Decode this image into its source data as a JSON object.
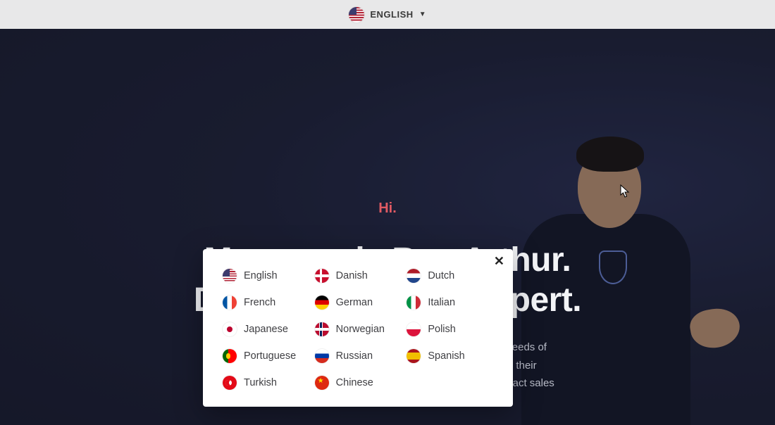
{
  "topbar": {
    "current_language_label": "ENGLISH",
    "current_language_flag": "us"
  },
  "hero": {
    "greeting": "Hi.",
    "headline_line1": "My name is Ben Arthur.",
    "headline_line2": "Digital Marketing Expert.",
    "sub_line1": "Beautiful websites and application often fail to address real needs of",
    "sub_line2": "your visitors. This results in visitors not finding a solution to their",
    "sub_line3": "problems, and then of course, website and apps that fail to attract sales"
  },
  "popup": {
    "close_glyph": "✕",
    "languages": [
      {
        "flag": "us",
        "label": "English"
      },
      {
        "flag": "dk",
        "label": "Danish"
      },
      {
        "flag": "nl",
        "label": "Dutch"
      },
      {
        "flag": "fr",
        "label": "French"
      },
      {
        "flag": "de",
        "label": "German"
      },
      {
        "flag": "it",
        "label": "Italian"
      },
      {
        "flag": "jp",
        "label": "Japanese"
      },
      {
        "flag": "no",
        "label": "Norwegian"
      },
      {
        "flag": "pl",
        "label": "Polish"
      },
      {
        "flag": "pt",
        "label": "Portuguese"
      },
      {
        "flag": "ru",
        "label": "Russian"
      },
      {
        "flag": "es",
        "label": "Spanish"
      },
      {
        "flag": "tr",
        "label": "Turkish"
      },
      {
        "flag": "cn",
        "label": "Chinese"
      }
    ]
  }
}
